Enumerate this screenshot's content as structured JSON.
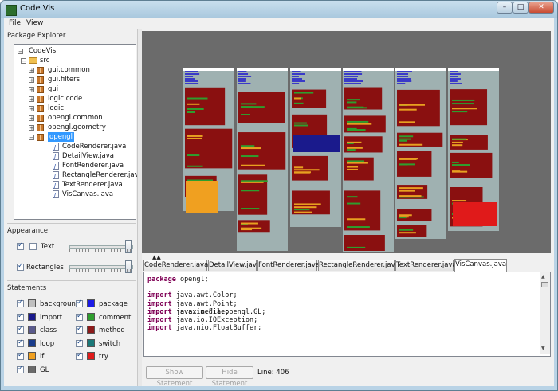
{
  "window": {
    "title": "Code Vis"
  },
  "menu": [
    "File",
    "View"
  ],
  "explorer": {
    "header": "Package Explorer",
    "root": "CodeVis",
    "src": "src",
    "packages": [
      "gui.common",
      "gui.filters",
      "gui",
      "logic.code",
      "logic",
      "opengl.common",
      "opengl.geometry",
      "opengl"
    ],
    "selected": "opengl",
    "files": [
      "CodeRenderer.java",
      "DetailView.java",
      "FontRenderer.java",
      "RectangleRenderer.java",
      "TextRenderer.java",
      "VisCanvas.java"
    ]
  },
  "appearance": {
    "header": "Appearance",
    "text_label": "Text",
    "text_checked": false,
    "rect_label": "Rectangles",
    "rect_checked": true
  },
  "statements": {
    "header": "Statements",
    "items": [
      {
        "label": "background",
        "color": "#c0c0c0",
        "checked": true
      },
      {
        "label": "package",
        "color": "#1a1ae6",
        "checked": true
      },
      {
        "label": "import",
        "color": "#1a1a8c",
        "checked": true
      },
      {
        "label": "comment",
        "color": "#2e9e2e",
        "checked": true
      },
      {
        "label": "class",
        "color": "#5a5a8c",
        "checked": true
      },
      {
        "label": "method",
        "color": "#8c1a1a",
        "checked": true
      },
      {
        "label": "loop",
        "color": "#1a3c8c",
        "checked": true
      },
      {
        "label": "switch",
        "color": "#1a7878",
        "checked": true
      },
      {
        "label": "if",
        "color": "#f0a020",
        "checked": true
      },
      {
        "label": "try",
        "color": "#e01a1a",
        "checked": true
      },
      {
        "label": "GL",
        "color": "#6a6a6a",
        "checked": true
      }
    ]
  },
  "tabs": [
    "CodeRenderer.java",
    "DetailView.java",
    "FontRenderer.java",
    "RectangleRenderer.java",
    "TextRenderer.java",
    "VisCanvas.java"
  ],
  "active_tab": "VisCanvas.java",
  "code": {
    "line1_kw": "package",
    "line1_rest": " opengl;",
    "imports": [
      "java.awt.Color;",
      "java.awt.Point;",
      "java.io.File;",
      "java.io.IOException;",
      "java.nio.FloatBuffer;"
    ],
    "import_kw": "import",
    "last_import": "javax.media.opengl.GL;"
  },
  "bottom": {
    "show_btn": "Show Statement",
    "hide_btn": "Hide Statement",
    "line_label": "Line: 406"
  }
}
